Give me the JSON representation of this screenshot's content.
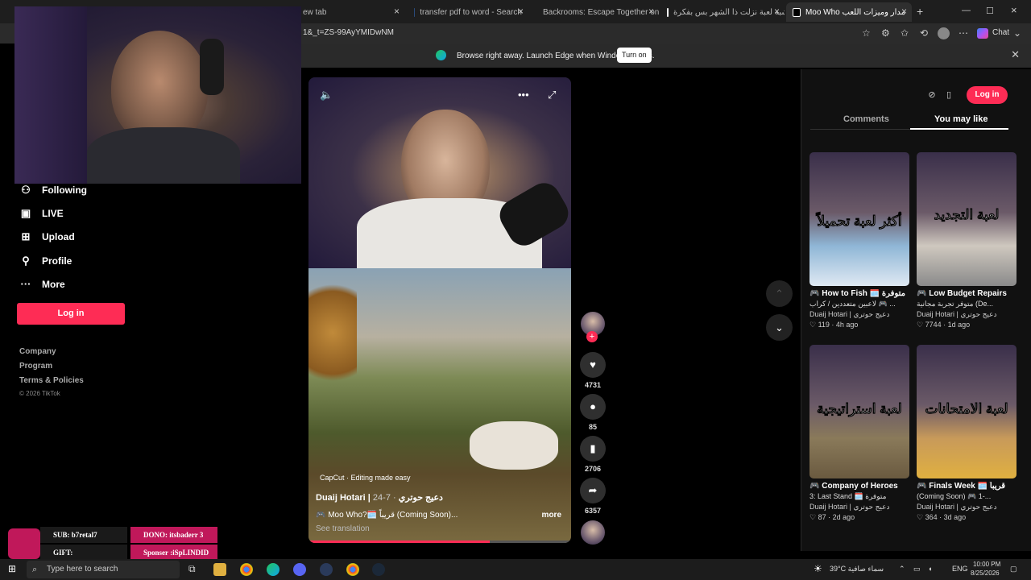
{
  "browser": {
    "tabs": [
      {
        "title": "ew tab"
      },
      {
        "title": "transfer pdf to word - Search"
      },
      {
        "title": "Backrooms: Escape Together on"
      },
      {
        "title": "تشبه لعبة نزلت ذا الشهر بس بفكرة"
      },
      {
        "title": "Moo Who مدار وميزات اللعب"
      }
    ],
    "url": "1&_t=ZS-99AyYMIDwNM",
    "chat_label": "Chat",
    "banner_text": "Browse right away. Launch Edge when Windows starts.",
    "banner_button": "Turn on"
  },
  "sidebar": {
    "items": [
      {
        "label": "Following",
        "icon": "following-icon"
      },
      {
        "label": "LIVE",
        "icon": "live-icon"
      },
      {
        "label": "Upload",
        "icon": "upload-icon"
      },
      {
        "label": "Profile",
        "icon": "profile-icon"
      },
      {
        "label": "More",
        "icon": "more-icon"
      }
    ],
    "login": "Log in",
    "footer": [
      "Company",
      "Program",
      "Terms & Policies",
      "© 2026 TikTok"
    ]
  },
  "video": {
    "capcut": "CapCut · Editing made easy",
    "author": "Duaij Hotari | دعيج حوتري",
    "date": "· 7-24",
    "description": "🎮 Moo Who?🗓️ قريباً (Coming Soon)...",
    "more": "more",
    "see_translation": "See translation",
    "progress": 0.69
  },
  "actions": {
    "likes": "4731",
    "comments": "85",
    "saves": "2706",
    "shares": "6357"
  },
  "right_panel": {
    "login": "Log in",
    "tabs": [
      "Comments",
      "You may like"
    ],
    "cards": [
      {
        "overlay": "أكثر لعبة تحميلاً",
        "title": "🎮 How to Fish 🗓️ متوفرة",
        "sub": "لاعبين متعددين / كراب 🎮 ...",
        "author": "Duaij Hotari | دعيج حوتري",
        "stats": "♡ 119 · 4h ago"
      },
      {
        "overlay": "لعبة التجديد",
        "title": "🎮 Low Budget Repairs",
        "sub": "متوفر تجربة مجانية (De...",
        "author": "Duaij Hotari | دعيج حوتري",
        "stats": "♡ 7744 · 1d ago"
      },
      {
        "overlay": "لعبة استراتيجية",
        "title": "🎮 Company of Heroes",
        "sub": "3: Last Stand 🗓️ متوفرة",
        "author": "Duaij Hotari | دعيج حوتري",
        "stats": "♡ 87 · 2d ago"
      },
      {
        "overlay": "لعبة الامتحانات",
        "title": "🎮 Finals Week 🗓️ قريباً",
        "sub": "(Coming Soon) 🎮 1-...",
        "author": "Duaij Hotari | دعيج حوتري",
        "stats": "♡ 364 · 3d ago"
      }
    ]
  },
  "stream_alerts": {
    "sub": "SUB: b7retal7",
    "gift": "GIFT:",
    "dono": "DONO: itsbaderr 3",
    "sponsor": "Sponser :iSpLINDID"
  },
  "taskbar": {
    "search_placeholder": "Type here to search",
    "weather": "39°C  سماء صافية",
    "lang": "ENG",
    "time": "10:00 PM",
    "date": "8/25/2026"
  }
}
